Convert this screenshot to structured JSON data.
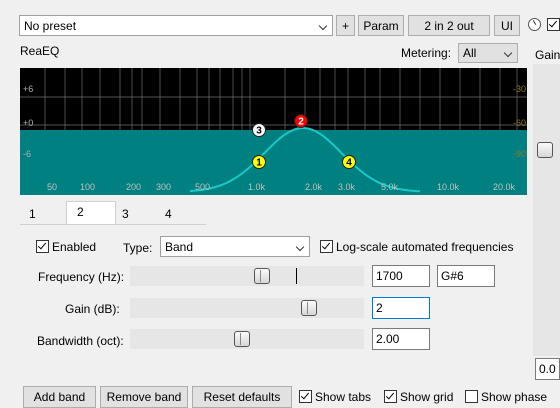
{
  "toolbar": {
    "preset": "No preset",
    "plus_label": "+",
    "param_label": "Param",
    "io_label": "2 in 2 out",
    "ui_label": "UI"
  },
  "header": {
    "plugin_name": "ReaEQ",
    "metering_label": "Metering:",
    "metering_value": "All",
    "gain_label": "Gain:"
  },
  "graph": {
    "db_labels": [
      "+6",
      "+0",
      "-6"
    ],
    "right_labels": [
      "-30",
      "-60",
      "-90"
    ],
    "freq_labels": [
      "50",
      "100",
      "200",
      "300",
      "500",
      "1.0k",
      "2.0k",
      "3.0k",
      "5.0k",
      "10.0k",
      "20.0k"
    ],
    "points": [
      "1",
      "2",
      "3",
      "4"
    ],
    "colors": {
      "fill": "#008080",
      "curve": "#1ac8c8",
      "bg": "#000000",
      "active_point": "#ff0000",
      "edge_point": "#ffff00"
    }
  },
  "tabs": [
    "1",
    "2",
    "3",
    "4"
  ],
  "band": {
    "enabled_label": "Enabled",
    "enabled": true,
    "type_label": "Type:",
    "type_value": "Band",
    "logscale_label": "Log-scale automated frequencies",
    "logscale": true,
    "frequency_label": "Frequency (Hz):",
    "frequency_value": "1700",
    "note_value": "G#6",
    "gain_label": "Gain (dB):",
    "gain_value": "2",
    "bandwidth_label": "Bandwidth (oct):",
    "bandwidth_value": "2.00"
  },
  "output_gain": {
    "value": "0.0"
  },
  "bottom": {
    "add_band": "Add band",
    "remove_band": "Remove band",
    "reset_defaults": "Reset defaults",
    "show_tabs": "Show tabs",
    "show_grid": "Show grid",
    "show_phase": "Show phase",
    "show_tabs_checked": true,
    "show_grid_checked": true,
    "show_phase_checked": false
  }
}
